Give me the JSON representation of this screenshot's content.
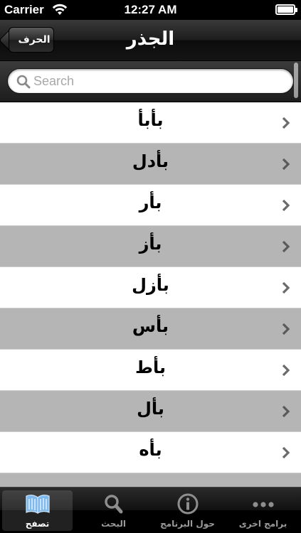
{
  "status_bar": {
    "carrier": "Carrier",
    "time": "12:27 AM"
  },
  "nav": {
    "title": "الجذر",
    "back_label": "الحرف"
  },
  "search": {
    "placeholder": "Search"
  },
  "roots": [
    "بأبأ",
    "بأدل",
    "بأر",
    "بأز",
    "بأزل",
    "بأس",
    "بأط",
    "بأل",
    "بأه"
  ],
  "tabs": [
    {
      "label": "تصفح",
      "icon": "book-icon",
      "active": true
    },
    {
      "label": "البحث",
      "icon": "search-icon",
      "active": false
    },
    {
      "label": "حول البرنامج",
      "icon": "info-icon",
      "active": false
    },
    {
      "label": "برامج اخرى",
      "icon": "more-icon",
      "active": false
    }
  ],
  "colors": {
    "row_alt": "#b5b5b5",
    "row_plain": "#ffffff",
    "tab_active_icon": "#7fb9ec"
  }
}
